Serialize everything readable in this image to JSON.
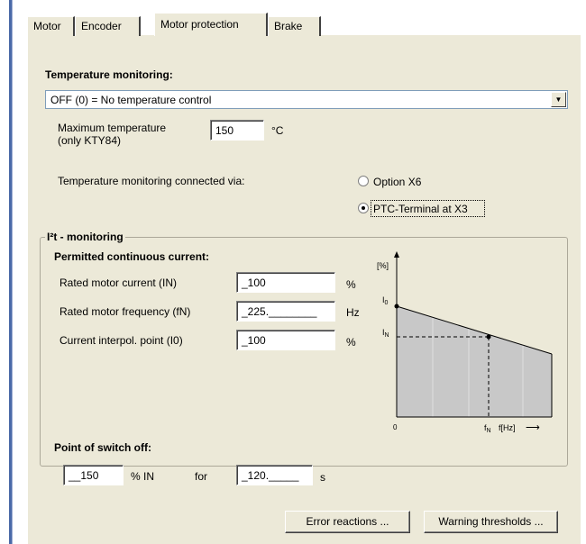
{
  "tabs": [
    {
      "label": "Motor"
    },
    {
      "label": "Encoder"
    },
    {
      "label": "Motor protection"
    },
    {
      "label": "Brake"
    }
  ],
  "temperature": {
    "title": "Temperature monitoring:",
    "mode_selected": "OFF (0) = No temperature control",
    "max_temp_label_line1": "Maximum temperature",
    "max_temp_label_line2": "(only KTY84)",
    "max_temp_value": "150",
    "max_temp_unit": "°C",
    "connected_via_label": "Temperature monitoring connected via:",
    "option_x6": "Option X6",
    "option_ptc": "PTC-Terminal at X3",
    "selected_option": "PTC-Terminal at X3"
  },
  "i2t": {
    "title": "I²t - monitoring",
    "permitted_title": "Permitted continuous current:",
    "rated_current_label": "Rated motor current (IN)",
    "rated_current_value": "_100",
    "rated_current_unit": "%",
    "rated_freq_label": "Rated motor frequency (fN)",
    "rated_freq_value": "_225.________",
    "rated_freq_unit": "Hz",
    "interpol_label": "Current interpol. point (I0)",
    "interpol_value": "_100",
    "interpol_unit": "%",
    "graph": {
      "y_axis_label": "[%]",
      "i0_label": "I",
      "i0_sub": "0",
      "in_label": "I",
      "in_sub": "N",
      "origin_label": "0",
      "fn_label": "f",
      "fn_sub": "N",
      "x_axis_label": "f[Hz]",
      "x_arrow": "⟶",
      "fill_color": "#c8c8c8"
    },
    "switch_off_title": "Point of switch off:",
    "switch_off_value": "__150",
    "switch_off_unit": "% IN",
    "for_label": "for",
    "time_value": "_120._____",
    "time_unit": "s"
  },
  "buttons": {
    "error_reactions": "Error reactions ...",
    "warning_thresholds": "Warning thresholds ..."
  }
}
